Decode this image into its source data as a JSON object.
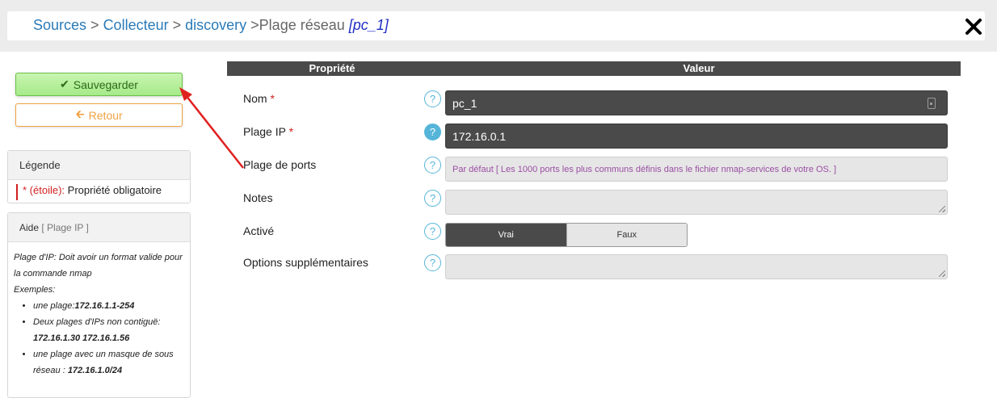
{
  "breadcrumb": {
    "items": [
      "Sources",
      "Collecteur",
      "discovery"
    ],
    "separator": ">",
    "current": "Plage réseau",
    "object": "[pc_1]"
  },
  "actions": {
    "save_label": "Sauvegarder",
    "back_label": "Retour"
  },
  "legend": {
    "title": "Légende",
    "star_label": "* (étoile):",
    "star_meaning": "Propriété obligatoire"
  },
  "help": {
    "title": "Aide",
    "context": "[ Plage IP ]",
    "intro": "Plage d'IP: Doit avoir un format valide pour la commande nmap",
    "examples_label": "Exemples:",
    "examples": [
      {
        "text": "une plage:",
        "value": "172.16.1.1-254"
      },
      {
        "text": "Deux plages d'IPs non contiguë:",
        "value": "172.16.1.30 172.16.1.56"
      },
      {
        "text": "une plage avec un masque de sous réseau :",
        "value": "172.16.1.0/24"
      }
    ]
  },
  "table": {
    "col_property": "Propriété",
    "col_value": "Valeur"
  },
  "fields": {
    "nom": {
      "label": "Nom",
      "required": "*",
      "value": "pc_1"
    },
    "plage_ip": {
      "label": "Plage IP",
      "required": "*",
      "value": "172.16.0.1"
    },
    "plage_ports": {
      "label": "Plage de ports",
      "placeholder": "Par défaut [ Les 1000 ports les plus communs définis dans le fichier nmap-services de votre OS. ]"
    },
    "notes": {
      "label": "Notes",
      "value": ""
    },
    "active": {
      "label": "Activé",
      "true_label": "Vrai",
      "false_label": "Faux",
      "selected": "Vrai"
    },
    "options": {
      "label": "Options supplémentaires",
      "value": ""
    }
  },
  "help_icon_glyph": "?",
  "colors": {
    "link": "#2a7ab8",
    "required": "#d21f1f",
    "help_icon": "#55b5d8",
    "save_green": "#a6ea8a",
    "back_orange": "#f0a243",
    "annotation_arrow": "#e02020"
  }
}
